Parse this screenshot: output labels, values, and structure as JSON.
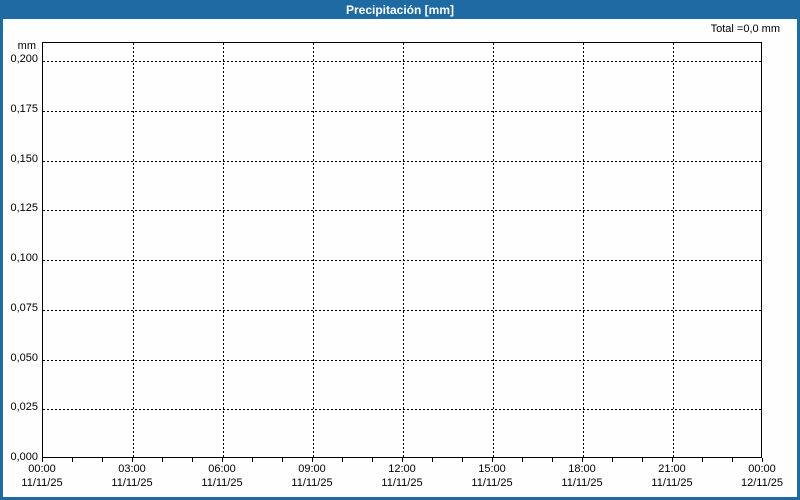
{
  "header": {
    "title": "Precipitación [mm]"
  },
  "total_label": "Total =0,0 mm",
  "colors": {
    "accent_blue": "#1e6ba4",
    "grid": "#000000",
    "background": "#fefefe",
    "title_text": "#ffffff",
    "axis_text": "#000000"
  },
  "chart_data": {
    "type": "bar",
    "title": "Precipitación [mm]",
    "xlabel": "",
    "ylabel": "mm",
    "ylim": [
      0,
      0.209
    ],
    "y_tick_step": 0.025,
    "y_ticks": [
      "0,200",
      "0,175",
      "0,150",
      "0,125",
      "0,100",
      "0,075",
      "0,050",
      "0,025",
      "0,000"
    ],
    "x_ticks": [
      {
        "time": "00:00",
        "date": "11/11/25"
      },
      {
        "time": "03:00",
        "date": "11/11/25"
      },
      {
        "time": "06:00",
        "date": "11/11/25"
      },
      {
        "time": "09:00",
        "date": "11/11/25"
      },
      {
        "time": "12:00",
        "date": "11/11/25"
      },
      {
        "time": "15:00",
        "date": "11/11/25"
      },
      {
        "time": "18:00",
        "date": "11/11/25"
      },
      {
        "time": "21:00",
        "date": "11/11/25"
      },
      {
        "time": "00:00",
        "date": "12/11/25"
      }
    ],
    "x_range_hours": 24,
    "minor_tick_interval_hours": 1,
    "major_gridline_interval_hours": 3,
    "grid": true,
    "grid_style": "dashed",
    "legend_position": "none",
    "series": [
      {
        "name": "Precipitación",
        "values": []
      }
    ],
    "total_mm": 0.0,
    "annotation": "Total =0,0 mm"
  }
}
